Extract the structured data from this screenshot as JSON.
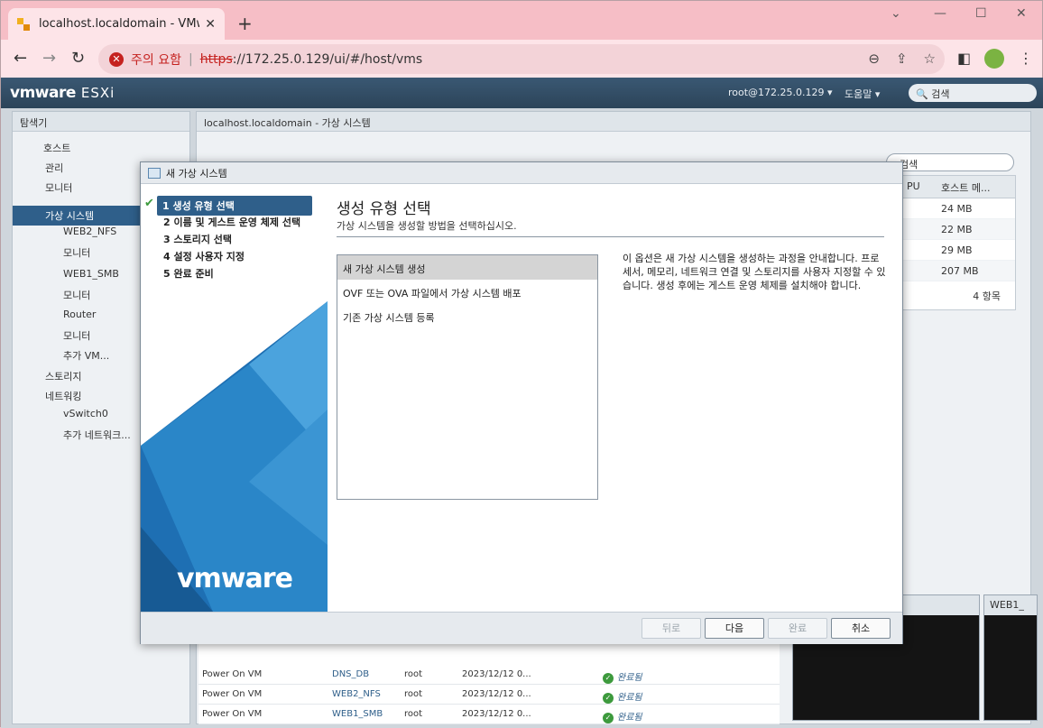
{
  "browser": {
    "tab_title": "localhost.localdomain - VMware",
    "new_tab": "+",
    "security_label": "주의 요함",
    "url_scheme": "https",
    "url_rest": "://172.25.0.129/ui/#/host/vms",
    "min": "⌄",
    "max": "—",
    "restore": "☐",
    "close": "✕"
  },
  "esxi": {
    "logo": "vmware",
    "logo_product": "ESXi",
    "user": "root@172.25.0.129 ▾",
    "help": "도움말 ▾",
    "search_placeholder": "검색"
  },
  "navigator": {
    "title": "탐색기",
    "items": [
      {
        "label": "호스트"
      },
      {
        "label": "관리"
      },
      {
        "label": "모니터"
      },
      {
        "label": "가상 시스템"
      },
      {
        "label": "WEB2_NFS"
      },
      {
        "label": "모니터"
      },
      {
        "label": "WEB1_SMB"
      },
      {
        "label": "모니터"
      },
      {
        "label": "Router"
      },
      {
        "label": "모니터"
      },
      {
        "label": "추가 VM..."
      },
      {
        "label": "스토리지"
      },
      {
        "label": "네트워킹"
      },
      {
        "label": "vSwitch0"
      },
      {
        "label": "추가 네트워크..."
      }
    ]
  },
  "content": {
    "title": "localhost.localdomain - 가상 시스템",
    "search": "검색",
    "col_cpu": "PU",
    "col_mem": "호스트 메...",
    "mem_values": [
      "24 MB",
      "22 MB",
      "29 MB",
      "207 MB"
    ],
    "count": "4 항목",
    "tasks": [
      {
        "task": "Power On VM",
        "target": "DNS_DB",
        "user": "root",
        "time": "2023/12/12 0...",
        "status": "완료됨"
      },
      {
        "task": "Power On VM",
        "target": "WEB2_NFS",
        "user": "root",
        "time": "2023/12/12 0...",
        "status": "완료됨"
      },
      {
        "task": "Power On VM",
        "target": "WEB1_SMB",
        "user": "root",
        "time": "2023/12/12 0...",
        "status": "완료됨"
      }
    ],
    "console_title": "WEB1_"
  },
  "wizard": {
    "title": "새 가상 시스템",
    "steps": [
      "1 생성 유형 선택",
      "2 이름 및 게스트 운영 체제 선택",
      "3 스토리지 선택",
      "4 설정 사용자 지정",
      "5 완료 준비"
    ],
    "logo": "vmware",
    "heading": "생성 유형 선택",
    "subheading": "가상 시스템을 생성할 방법을 선택하십시오.",
    "options": [
      "새 가상 시스템 생성",
      "OVF 또는 OVA 파일에서 가상 시스템 배포",
      "기존 가상 시스템 등록"
    ],
    "description": "이 옵션은 새 가상 시스템을 생성하는 과정을 안내합니다. 프로세서, 메모리, 네트워크 연결 및 스토리지를 사용자 지정할 수 있습니다. 생성 후에는 게스트 운영 체제를 설치해야 합니다.",
    "btn_back": "뒤로",
    "btn_next": "다음",
    "btn_finish": "완료",
    "btn_cancel": "취소",
    "accent": "#2f5f8a"
  }
}
